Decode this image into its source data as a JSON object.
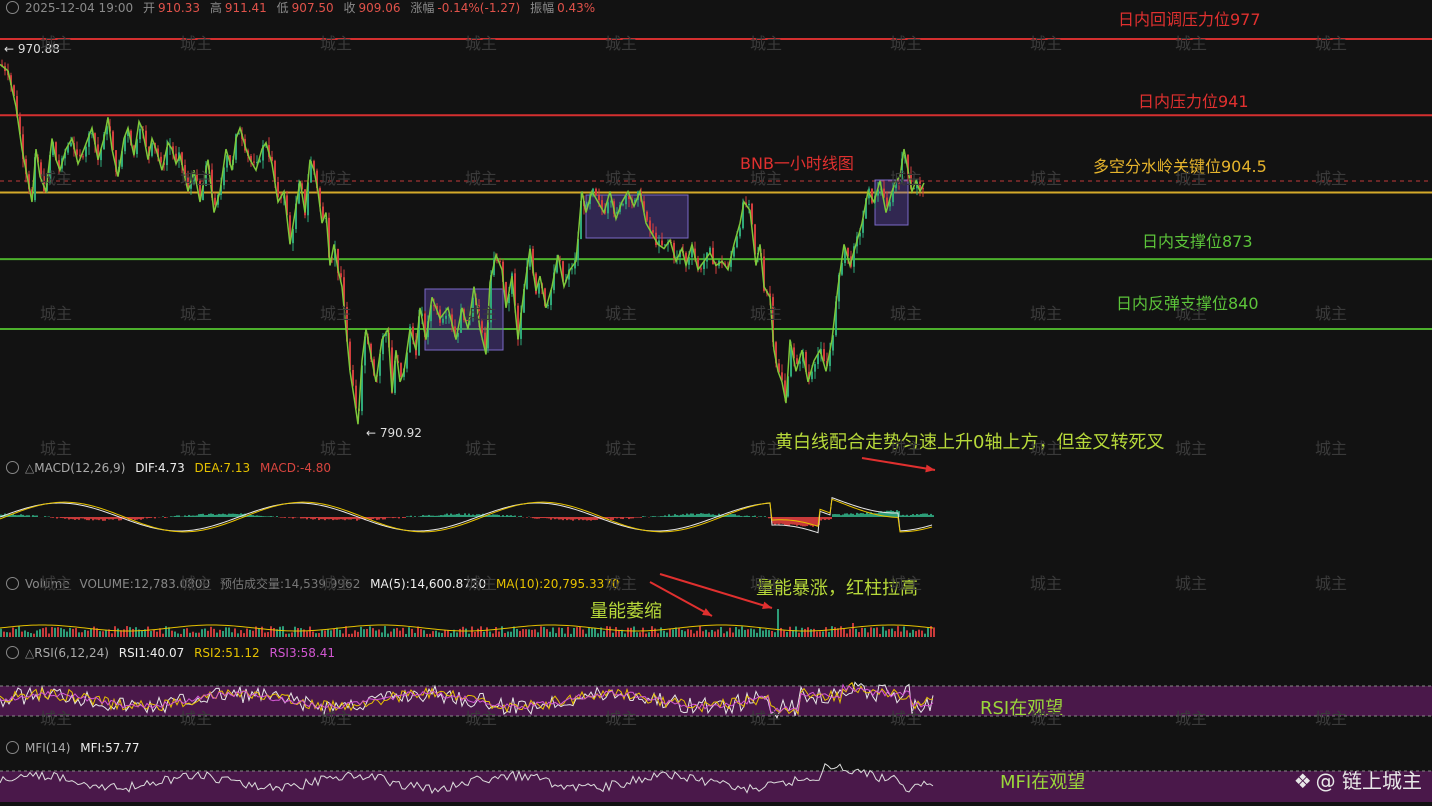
{
  "header": {
    "datetime": "2025-12-04 19:00",
    "open_label": "开",
    "open": "910.33",
    "high_label": "高",
    "high": "911.41",
    "low_label": "低",
    "low": "907.50",
    "close_label": "收",
    "close": "909.06",
    "change_label": "涨幅",
    "change": "-0.14%(-1.27)",
    "amp_label": "振幅",
    "amp": "0.43%"
  },
  "price_panel": {
    "title": "BNB一小时线图",
    "high_marker": "← 970.88",
    "low_marker": "← 790.92",
    "ylim": [
      775,
      985
    ],
    "levels": [
      {
        "label": "日内回调压力位977",
        "value": 977,
        "color": "#d42f2f"
      },
      {
        "label": "日内压力位941",
        "value": 941,
        "color": "#d42f2f"
      },
      {
        "label": "多空分水岭关键位904.5",
        "value": 904.5,
        "color": "#d4a92a"
      },
      {
        "label": "日内支撑位873",
        "value": 873,
        "color": "#4cb02c"
      },
      {
        "label": "日内反弹支撑位840",
        "value": 840,
        "color": "#4cb02c"
      }
    ],
    "dashed_current_price": 909
  },
  "macd": {
    "name": "MACD(12,26,9)",
    "dif": "DIF:4.73",
    "dea": "DEA:7.13",
    "macd": "MACD:-4.80"
  },
  "volume": {
    "name": "Volume",
    "vol": "VOLUME:12,783.0800",
    "est": "预估成交量:14,539.9962",
    "ma5": "MA(5):14,600.8720",
    "ma10": "MA(10):20,795.3370"
  },
  "rsi": {
    "name": "RSI(6,12,24)",
    "rsi1": "RSI1:40.07",
    "rsi2": "RSI2:51.12",
    "rsi3": "RSI3:58.41"
  },
  "mfi": {
    "name": "MFI(14)",
    "mfi": "MFI:57.77"
  },
  "annotations": {
    "macd_note": "黄白线配合走势匀速上升0轴上方，但金叉转死叉",
    "volume_up": "量能暴涨，红柱拉高",
    "volume_down": "量能萎缩",
    "rsi_note": "RSI在观望",
    "mfi_note": "MFI在观望"
  },
  "watermark": "城主",
  "brand": "@ 链上城主",
  "chart_data": {
    "type": "line",
    "title": "BNB一小时线图",
    "note": "approximate hourly close path (zigzag reading)",
    "x": [
      0,
      8,
      16,
      22,
      28,
      32,
      36,
      40,
      46,
      52,
      56,
      60,
      66,
      72,
      78,
      84,
      92,
      98,
      104,
      108,
      112,
      118,
      124,
      128,
      134,
      139,
      142,
      148,
      152,
      156,
      162,
      168,
      172,
      176,
      180,
      188,
      194,
      200,
      208,
      214,
      220,
      226,
      232,
      236,
      240,
      246,
      250,
      256,
      262,
      266,
      272,
      278,
      284,
      290,
      295,
      300,
      305,
      310,
      314,
      318,
      322,
      326,
      330,
      334,
      338,
      342,
      346,
      350,
      354,
      358,
      362,
      366,
      370,
      376,
      382,
      388,
      392,
      396,
      400,
      404,
      410,
      416,
      420,
      426,
      432,
      440,
      448,
      456,
      462,
      468,
      474,
      480,
      486,
      490,
      496,
      502,
      506,
      512,
      518,
      524,
      530,
      536,
      540,
      546,
      552,
      558,
      564,
      570,
      576,
      582,
      586,
      592,
      598,
      604,
      610,
      616,
      622,
      628,
      634,
      640,
      646,
      652,
      658,
      664,
      670,
      676,
      682,
      686,
      692,
      698,
      704,
      710,
      716,
      722,
      728,
      734,
      740,
      744,
      750,
      756,
      760,
      764,
      770,
      774,
      778,
      782,
      786,
      790,
      796,
      802,
      808,
      814,
      820,
      826,
      832,
      838,
      844,
      850,
      856,
      862,
      868,
      874,
      880,
      886,
      892,
      896,
      900,
      904,
      908,
      912,
      916,
      920,
      924,
      928,
      933
    ],
    "values": [
      965,
      962,
      945,
      925,
      910,
      900,
      925,
      912,
      905,
      930,
      920,
      915,
      925,
      930,
      918,
      925,
      935,
      920,
      930,
      940,
      925,
      912,
      930,
      935,
      922,
      938,
      935,
      920,
      930,
      925,
      915,
      928,
      925,
      918,
      922,
      905,
      915,
      900,
      920,
      895,
      905,
      925,
      915,
      930,
      935,
      925,
      920,
      915,
      925,
      928,
      918,
      900,
      905,
      880,
      895,
      910,
      895,
      920,
      915,
      905,
      890,
      895,
      870,
      880,
      868,
      860,
      840,
      820,
      808,
      795,
      825,
      840,
      830,
      815,
      835,
      840,
      810,
      830,
      815,
      820,
      840,
      830,
      850,
      835,
      855,
      845,
      850,
      835,
      850,
      840,
      860,
      840,
      828,
      862,
      875,
      868,
      850,
      865,
      835,
      858,
      878,
      858,
      865,
      850,
      860,
      875,
      860,
      868,
      872,
      905,
      895,
      905,
      900,
      895,
      905,
      892,
      900,
      905,
      898,
      905,
      890,
      885,
      880,
      878,
      882,
      872,
      878,
      870,
      880,
      868,
      872,
      876,
      870,
      872,
      868,
      880,
      890,
      900,
      896,
      870,
      880,
      860,
      855,
      830,
      820,
      815,
      805,
      835,
      820,
      830,
      815,
      825,
      830,
      820,
      835,
      860,
      880,
      870,
      880,
      890,
      905,
      900,
      910,
      895,
      905,
      910,
      912,
      925,
      915,
      905,
      910,
      905,
      909
    ]
  }
}
